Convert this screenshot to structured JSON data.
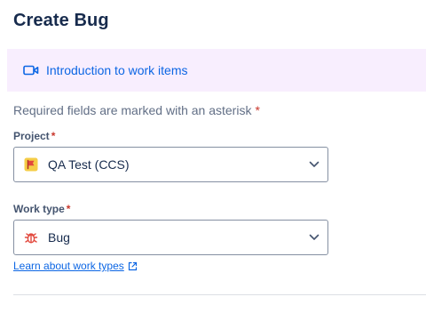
{
  "dialog": {
    "title": "Create Bug"
  },
  "banner": {
    "label": "Introduction to work items",
    "icon": "video-icon"
  },
  "form": {
    "required_note": "Required fields are marked with an asterisk",
    "required_marker": "*",
    "project": {
      "label": "Project",
      "value": "QA Test (CCS)",
      "icon": "project-flag-icon"
    },
    "work_type": {
      "label": "Work type",
      "value": "Bug",
      "icon": "bug-icon"
    },
    "learn_link": "Learn about work types"
  },
  "colors": {
    "accent": "#0c66e4",
    "required": "#c9372c",
    "banner_bg": "#f8eefe",
    "bug_red": "#e2483d",
    "project_yellow": "#f5cd47"
  }
}
